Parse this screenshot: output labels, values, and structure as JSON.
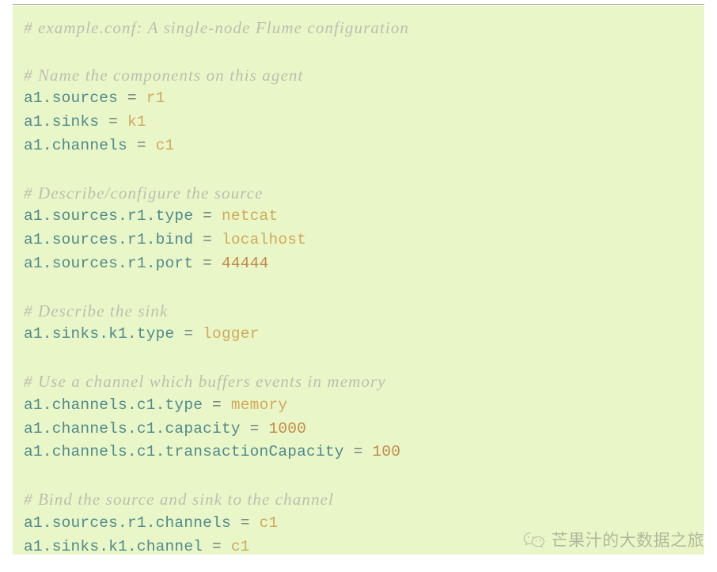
{
  "code_block": {
    "language": "properties",
    "background_color": "#e9f7c8",
    "colors": {
      "comment": "#bdbdb0",
      "key": "#4f8a8b",
      "operator": "#6b7d7a",
      "value": "#d0a95c",
      "number": "#c28a4a",
      "top_rule": "#9cb28b"
    },
    "lines": [
      {
        "type": "comment",
        "text": "# example.conf: A single-node Flume configuration"
      },
      {
        "type": "blank",
        "text": ""
      },
      {
        "type": "comment",
        "text": "# Name the components on this agent"
      },
      {
        "type": "kv",
        "key": "a1.sources",
        "op": " = ",
        "value": "r1",
        "value_kind": "value"
      },
      {
        "type": "kv",
        "key": "a1.sinks",
        "op": " = ",
        "value": "k1",
        "value_kind": "value"
      },
      {
        "type": "kv",
        "key": "a1.channels",
        "op": " = ",
        "value": "c1",
        "value_kind": "value"
      },
      {
        "type": "blank",
        "text": ""
      },
      {
        "type": "comment",
        "text": "# Describe/configure the source"
      },
      {
        "type": "kv",
        "key": "a1.sources.r1.type",
        "op": " = ",
        "value": "netcat",
        "value_kind": "value"
      },
      {
        "type": "kv",
        "key": "a1.sources.r1.bind",
        "op": " = ",
        "value": "localhost",
        "value_kind": "value"
      },
      {
        "type": "kv",
        "key": "a1.sources.r1.port",
        "op": " = ",
        "value": "44444",
        "value_kind": "number"
      },
      {
        "type": "blank",
        "text": ""
      },
      {
        "type": "comment",
        "text": "# Describe the sink"
      },
      {
        "type": "kv",
        "key": "a1.sinks.k1.type",
        "op": " = ",
        "value": "logger",
        "value_kind": "value"
      },
      {
        "type": "blank",
        "text": ""
      },
      {
        "type": "comment",
        "text": "# Use a channel which buffers events in memory"
      },
      {
        "type": "kv",
        "key": "a1.channels.c1.type",
        "op": " = ",
        "value": "memory",
        "value_kind": "value"
      },
      {
        "type": "kv",
        "key": "a1.channels.c1.capacity",
        "op": " = ",
        "value": "1000",
        "value_kind": "number"
      },
      {
        "type": "kv",
        "key": "a1.channels.c1.transactionCapacity",
        "op": " = ",
        "value": "100",
        "value_kind": "number"
      },
      {
        "type": "blank",
        "text": ""
      },
      {
        "type": "comment",
        "text": "# Bind the source and sink to the channel"
      },
      {
        "type": "kv",
        "key": "a1.sources.r1.channels",
        "op": " = ",
        "value": "c1",
        "value_kind": "value"
      },
      {
        "type": "kv",
        "key": "a1.sinks.k1.channel",
        "op": " = ",
        "value": "c1",
        "value_kind": "value"
      }
    ]
  },
  "watermark": {
    "icon": "wechat-icon",
    "text": "芒果汁的大数据之旅",
    "text_color": "#7a7a72"
  }
}
